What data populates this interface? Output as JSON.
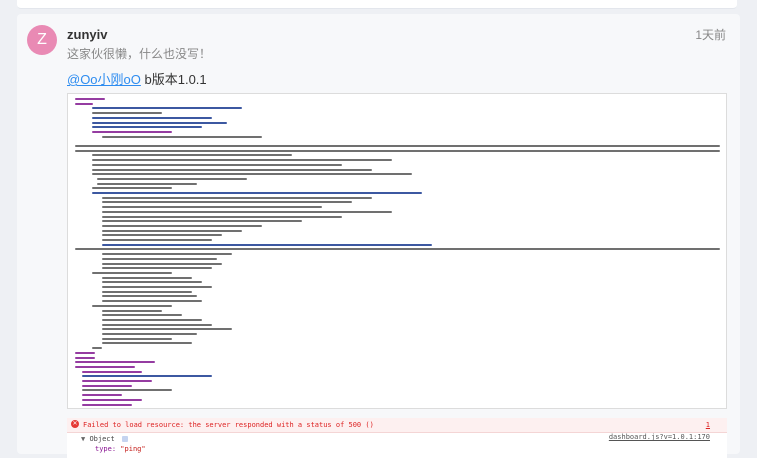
{
  "comment": {
    "avatar_letter": "Z",
    "avatar_color": "#e98ab4",
    "username": "zunyiv",
    "signature": "这家伙很懒，什么也没写！",
    "timestamp": "1天前",
    "mention": "@Oo小刚oO",
    "post_text": " b版本1.0.1"
  },
  "console": {
    "error_icon": "error-x-icon",
    "error_text": "Failed to load resource: the server responded with a status of 500 ()",
    "error_count": "1",
    "object_label": "Object",
    "source_link": "dashboard.js?v=1.0.1:170",
    "type_key": "type:",
    "type_value": "\"ping\""
  }
}
